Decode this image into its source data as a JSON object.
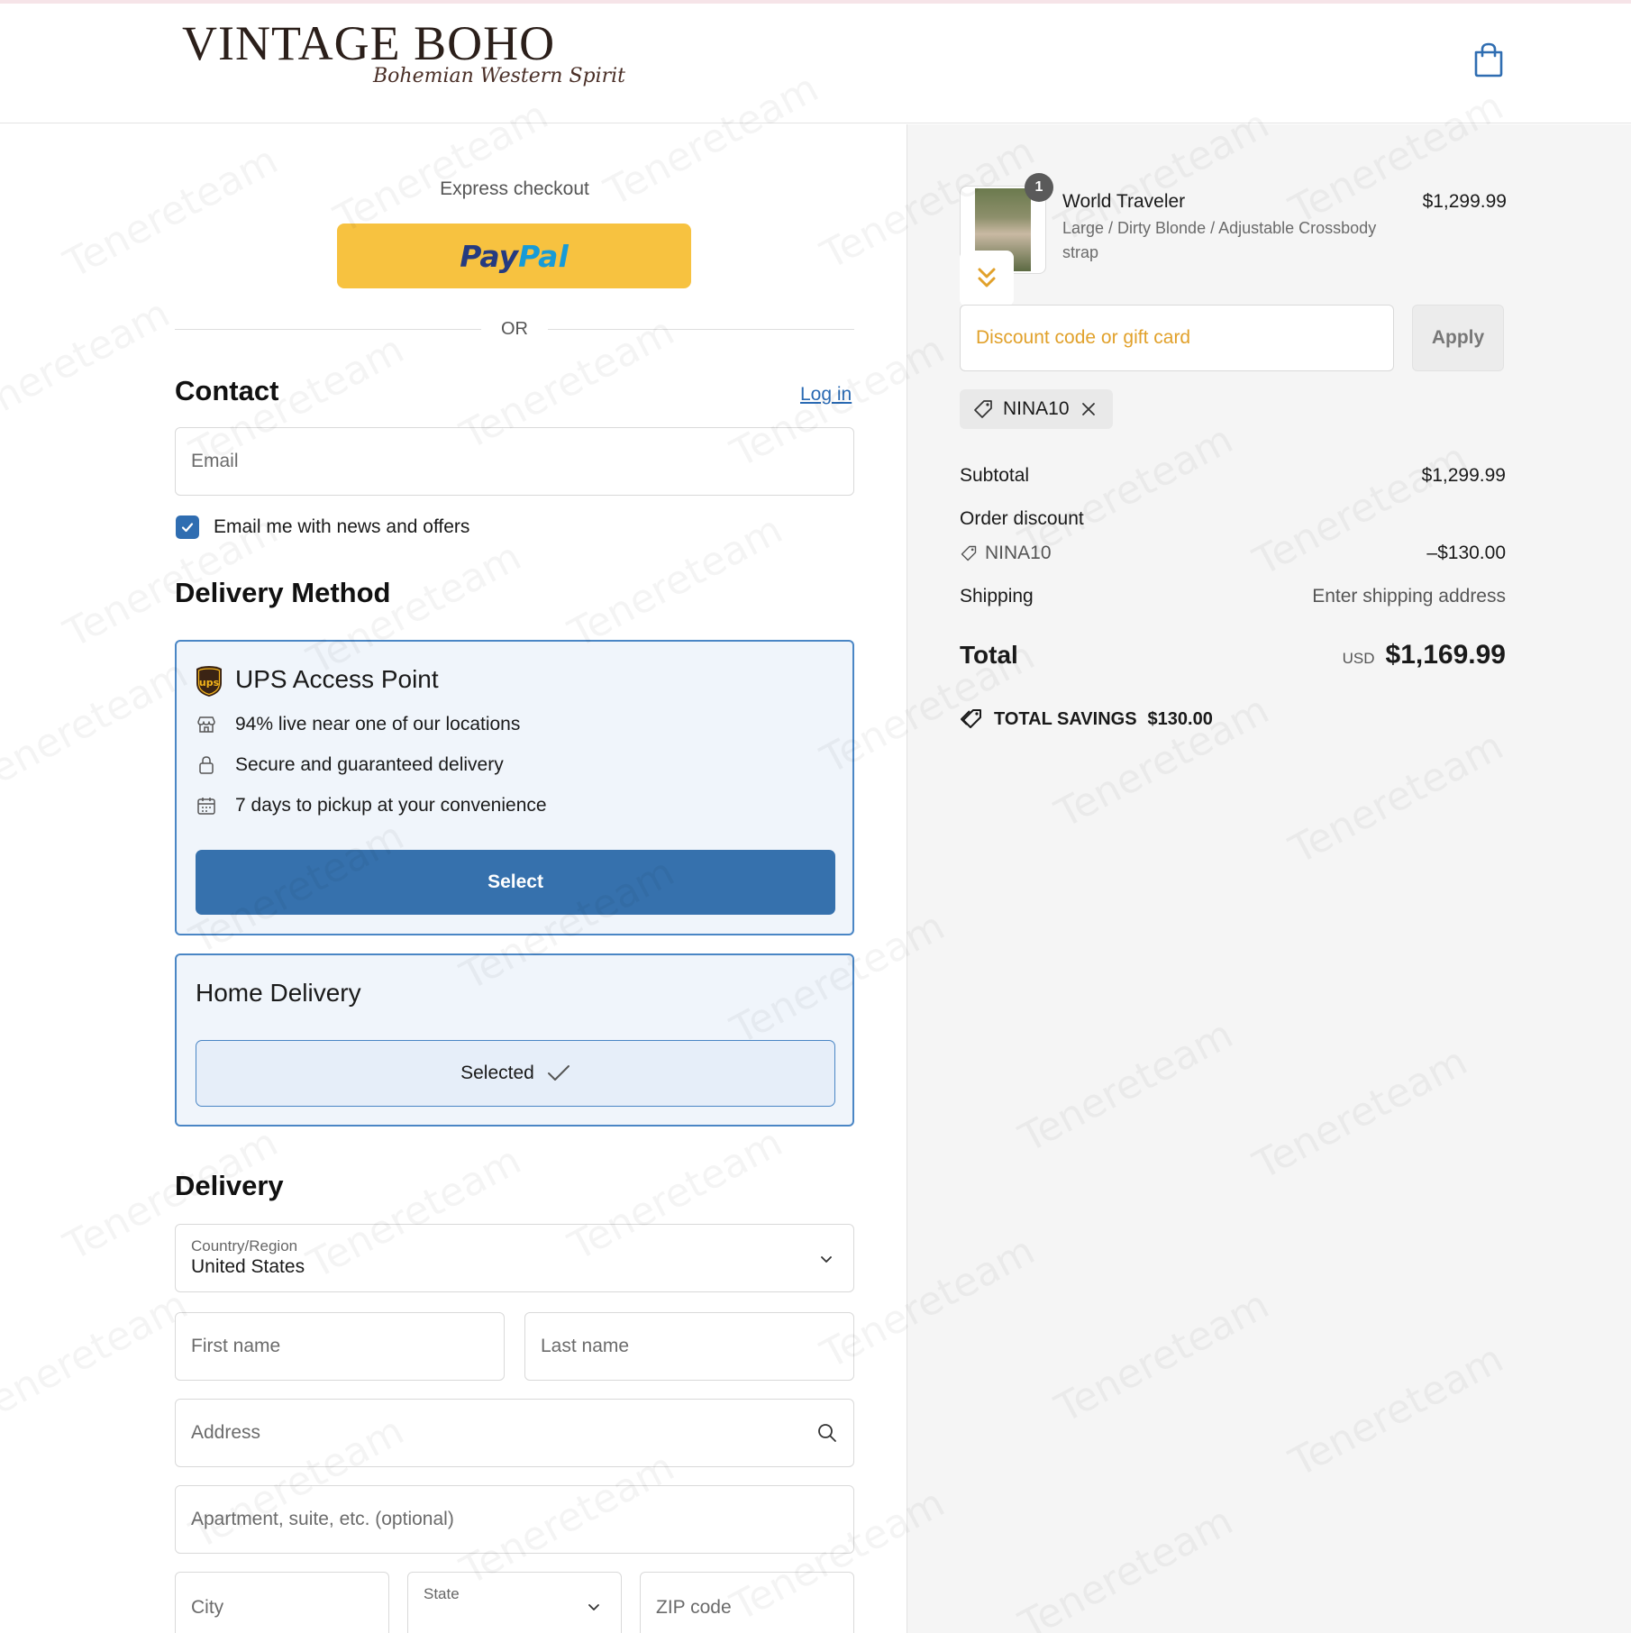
{
  "brand": {
    "name": "VINTAGE BOHO",
    "tagline": "Bohemian Western Spirit"
  },
  "watermark": "Tenereteam",
  "express": {
    "label": "Express checkout",
    "paypal_a": "Pay",
    "paypal_b": "Pal",
    "or_text": "OR"
  },
  "contact": {
    "title": "Contact",
    "login_link": "Log in",
    "email_placeholder": "Email",
    "news_checkbox_label": "Email me with news and offers",
    "news_checked": true
  },
  "delivery_method": {
    "title": "Delivery Method",
    "ups": {
      "title": "UPS Access Point",
      "features": [
        "94% live near one of our locations",
        "Secure and guaranteed delivery",
        "7 days to pickup at your convenience"
      ],
      "button_label": "Select"
    },
    "home": {
      "title": "Home Delivery",
      "button_label": "Selected"
    }
  },
  "delivery": {
    "title": "Delivery",
    "country_label": "Country/Region",
    "country_value": "United States",
    "first_name_placeholder": "First name",
    "last_name_placeholder": "Last name",
    "address_placeholder": "Address",
    "apartment_placeholder": "Apartment, suite, etc. (optional)",
    "city_placeholder": "City",
    "state_label": "State",
    "zip_placeholder": "ZIP code"
  },
  "order": {
    "item": {
      "name": "World Traveler",
      "variant": "Large / Dirty Blonde / Adjustable Crossbody strap",
      "price": "$1,299.99",
      "quantity": "1"
    },
    "discount_placeholder": "Discount code or gift card",
    "apply_label": "Apply",
    "applied_code": "NINA10",
    "subtotal_label": "Subtotal",
    "subtotal_value": "$1,299.99",
    "order_discount_label": "Order discount",
    "discount_code": "NINA10",
    "discount_value": "–$130.00",
    "shipping_label": "Shipping",
    "shipping_value": "Enter shipping address",
    "total_label": "Total",
    "currency": "USD",
    "total_value": "$1,169.99",
    "savings_label": "TOTAL SAVINGS",
    "savings_value": "$130.00"
  },
  "colors": {
    "accent": "#3671ad",
    "paypal_yellow": "#f7c240",
    "discount_placeholder": "#e1a12b"
  }
}
